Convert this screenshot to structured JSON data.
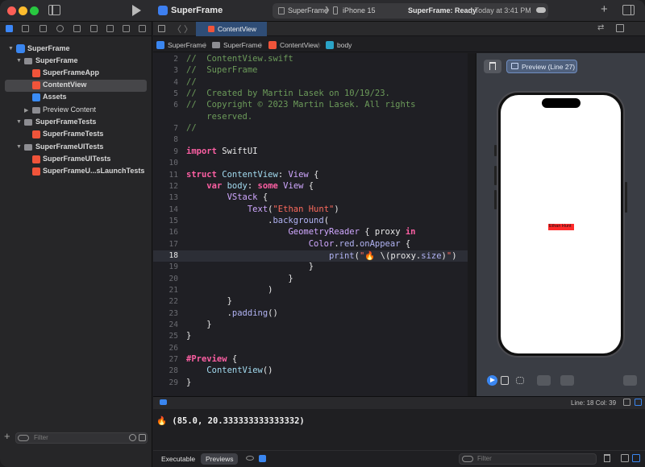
{
  "toolbar": {
    "project_name": "SuperFrame",
    "scheme_target": "SuperFrame",
    "chevron": "❯",
    "device": "iPhone 15",
    "status": "SuperFrame: Ready",
    "status_time": "| Today at 3:41 PM",
    "plus": "+"
  },
  "navigator": {
    "items": [
      {
        "label": "SuperFrame",
        "kind": "project"
      },
      {
        "label": "SuperFrame",
        "kind": "folder"
      },
      {
        "label": "SuperFrameApp",
        "kind": "swift-file"
      },
      {
        "label": "ContentView",
        "kind": "swift-file",
        "selected": true
      },
      {
        "label": "Assets",
        "kind": "asset-catalog"
      },
      {
        "label": "Preview Content",
        "kind": "folder"
      },
      {
        "label": "SuperFrameTests",
        "kind": "folder"
      },
      {
        "label": "SuperFrameTests",
        "kind": "swift-file"
      },
      {
        "label": "SuperFrameUITests",
        "kind": "folder"
      },
      {
        "label": "SuperFrameUITests",
        "kind": "swift-file"
      },
      {
        "label": "SuperFrameU...sLaunchTests",
        "kind": "swift-file"
      }
    ],
    "filter_placeholder": "Filter",
    "add_label": "+"
  },
  "tabbar": {
    "back": "〈",
    "forward": "〉",
    "active_tab": "ContentView",
    "right_icon": "⇄"
  },
  "jumpbar": {
    "items": [
      "SuperFrame",
      "SuperFrame",
      "ContentView",
      "body"
    ],
    "separator": "〉"
  },
  "editor": {
    "current_line": "18",
    "lines": [
      {
        "n": "2",
        "code": [
          {
            "t": "//  ContentView.swift",
            "c": "com"
          }
        ]
      },
      {
        "n": "3",
        "code": [
          {
            "t": "//  SuperFrame",
            "c": "com"
          }
        ]
      },
      {
        "n": "4",
        "code": [
          {
            "t": "//",
            "c": "com"
          }
        ]
      },
      {
        "n": "5",
        "code": [
          {
            "t": "//  Created by Martin Lasek on 10/19/23.",
            "c": "com"
          }
        ]
      },
      {
        "n": "6",
        "code": [
          {
            "t": "//  Copyright © 2023 Martin Lasek. All rights",
            "c": "com"
          }
        ]
      },
      {
        "n": "",
        "code": [
          {
            "t": "    reserved.",
            "c": "com"
          }
        ]
      },
      {
        "n": "7",
        "code": [
          {
            "t": "//",
            "c": "com"
          }
        ]
      },
      {
        "n": "8",
        "code": []
      },
      {
        "n": "9",
        "code": [
          {
            "t": "import",
            "c": "kw"
          },
          {
            "t": " SwiftUI",
            "c": ""
          }
        ]
      },
      {
        "n": "10",
        "code": []
      },
      {
        "n": "11",
        "code": [
          {
            "t": "struct",
            "c": "kw"
          },
          {
            "t": " ",
            "c": ""
          },
          {
            "t": "ContentView",
            "c": "typ2"
          },
          {
            "t": ": ",
            "c": ""
          },
          {
            "t": "View",
            "c": "typ"
          },
          {
            "t": " {",
            "c": ""
          }
        ]
      },
      {
        "n": "12",
        "code": [
          {
            "t": "    ",
            "c": ""
          },
          {
            "t": "var",
            "c": "kw"
          },
          {
            "t": " ",
            "c": ""
          },
          {
            "t": "body",
            "c": "typ2"
          },
          {
            "t": ": ",
            "c": ""
          },
          {
            "t": "some",
            "c": "kw"
          },
          {
            "t": " ",
            "c": ""
          },
          {
            "t": "View",
            "c": "typ"
          },
          {
            "t": " {",
            "c": ""
          }
        ]
      },
      {
        "n": "13",
        "code": [
          {
            "t": "        ",
            "c": ""
          },
          {
            "t": "VStack",
            "c": "typ"
          },
          {
            "t": " {",
            "c": ""
          }
        ]
      },
      {
        "n": "14",
        "code": [
          {
            "t": "            ",
            "c": ""
          },
          {
            "t": "Text",
            "c": "typ"
          },
          {
            "t": "(",
            "c": ""
          },
          {
            "t": "\"Ethan Hunt\"",
            "c": "str"
          },
          {
            "t": ")",
            "c": ""
          }
        ]
      },
      {
        "n": "15",
        "code": [
          {
            "t": "                .",
            "c": ""
          },
          {
            "t": "background",
            "c": "fn"
          },
          {
            "t": "(",
            "c": ""
          }
        ]
      },
      {
        "n": "16",
        "code": [
          {
            "t": "                    ",
            "c": ""
          },
          {
            "t": "GeometryReader",
            "c": "typ"
          },
          {
            "t": " { proxy ",
            "c": ""
          },
          {
            "t": "in",
            "c": "kw"
          }
        ]
      },
      {
        "n": "17",
        "code": [
          {
            "t": "                        ",
            "c": ""
          },
          {
            "t": "Color",
            "c": "typ"
          },
          {
            "t": ".",
            "c": ""
          },
          {
            "t": "red",
            "c": "fn"
          },
          {
            "t": ".",
            "c": ""
          },
          {
            "t": "onAppear",
            "c": "fn"
          },
          {
            "t": " {",
            "c": ""
          }
        ]
      },
      {
        "n": "18",
        "code": [
          {
            "t": "                            ",
            "c": ""
          },
          {
            "t": "print",
            "c": "fn"
          },
          {
            "t": "(",
            "c": ""
          },
          {
            "t": "\"🔥 ",
            "c": "str"
          },
          {
            "t": "\\(proxy.",
            "c": ""
          },
          {
            "t": "size",
            "c": "fn"
          },
          {
            "t": ")",
            "c": ""
          },
          {
            "t": "\"",
            "c": "str"
          },
          {
            "t": ")",
            "c": ""
          }
        ]
      },
      {
        "n": "19",
        "code": [
          {
            "t": "                        }",
            "c": ""
          }
        ]
      },
      {
        "n": "20",
        "code": [
          {
            "t": "                    }",
            "c": ""
          }
        ]
      },
      {
        "n": "21",
        "code": [
          {
            "t": "                )",
            "c": ""
          }
        ]
      },
      {
        "n": "22",
        "code": [
          {
            "t": "        }",
            "c": ""
          }
        ]
      },
      {
        "n": "23",
        "code": [
          {
            "t": "        .",
            "c": ""
          },
          {
            "t": "padding",
            "c": "fn"
          },
          {
            "t": "()",
            "c": ""
          }
        ]
      },
      {
        "n": "24",
        "code": [
          {
            "t": "    }",
            "c": ""
          }
        ]
      },
      {
        "n": "25",
        "code": [
          {
            "t": "}",
            "c": ""
          }
        ]
      },
      {
        "n": "26",
        "code": []
      },
      {
        "n": "27",
        "code": [
          {
            "t": "#Preview",
            "c": "kw"
          },
          {
            "t": " {",
            "c": ""
          }
        ]
      },
      {
        "n": "28",
        "code": [
          {
            "t": "    ",
            "c": ""
          },
          {
            "t": "ContentView",
            "c": "typ2"
          },
          {
            "t": "()",
            "c": ""
          }
        ]
      },
      {
        "n": "29",
        "code": [
          {
            "t": "}",
            "c": ""
          }
        ]
      }
    ]
  },
  "canvas": {
    "preview_label": "Preview (Line 27)",
    "preview_text": "Ethan Hunt"
  },
  "debug": {
    "line_col": "Line: 18  Col: 39",
    "console_output": "🔥 (85.0, 20.333333333333332)",
    "tabs": [
      "Executable",
      "Previews"
    ],
    "active_tab": "Previews",
    "filter_placeholder": "Filter"
  },
  "colors": {
    "accent": "#3b86f7",
    "keyword": "#fc5fa3",
    "comment": "#6c9b5a",
    "string": "#fc6a5d",
    "type": "#d0a8ff"
  }
}
